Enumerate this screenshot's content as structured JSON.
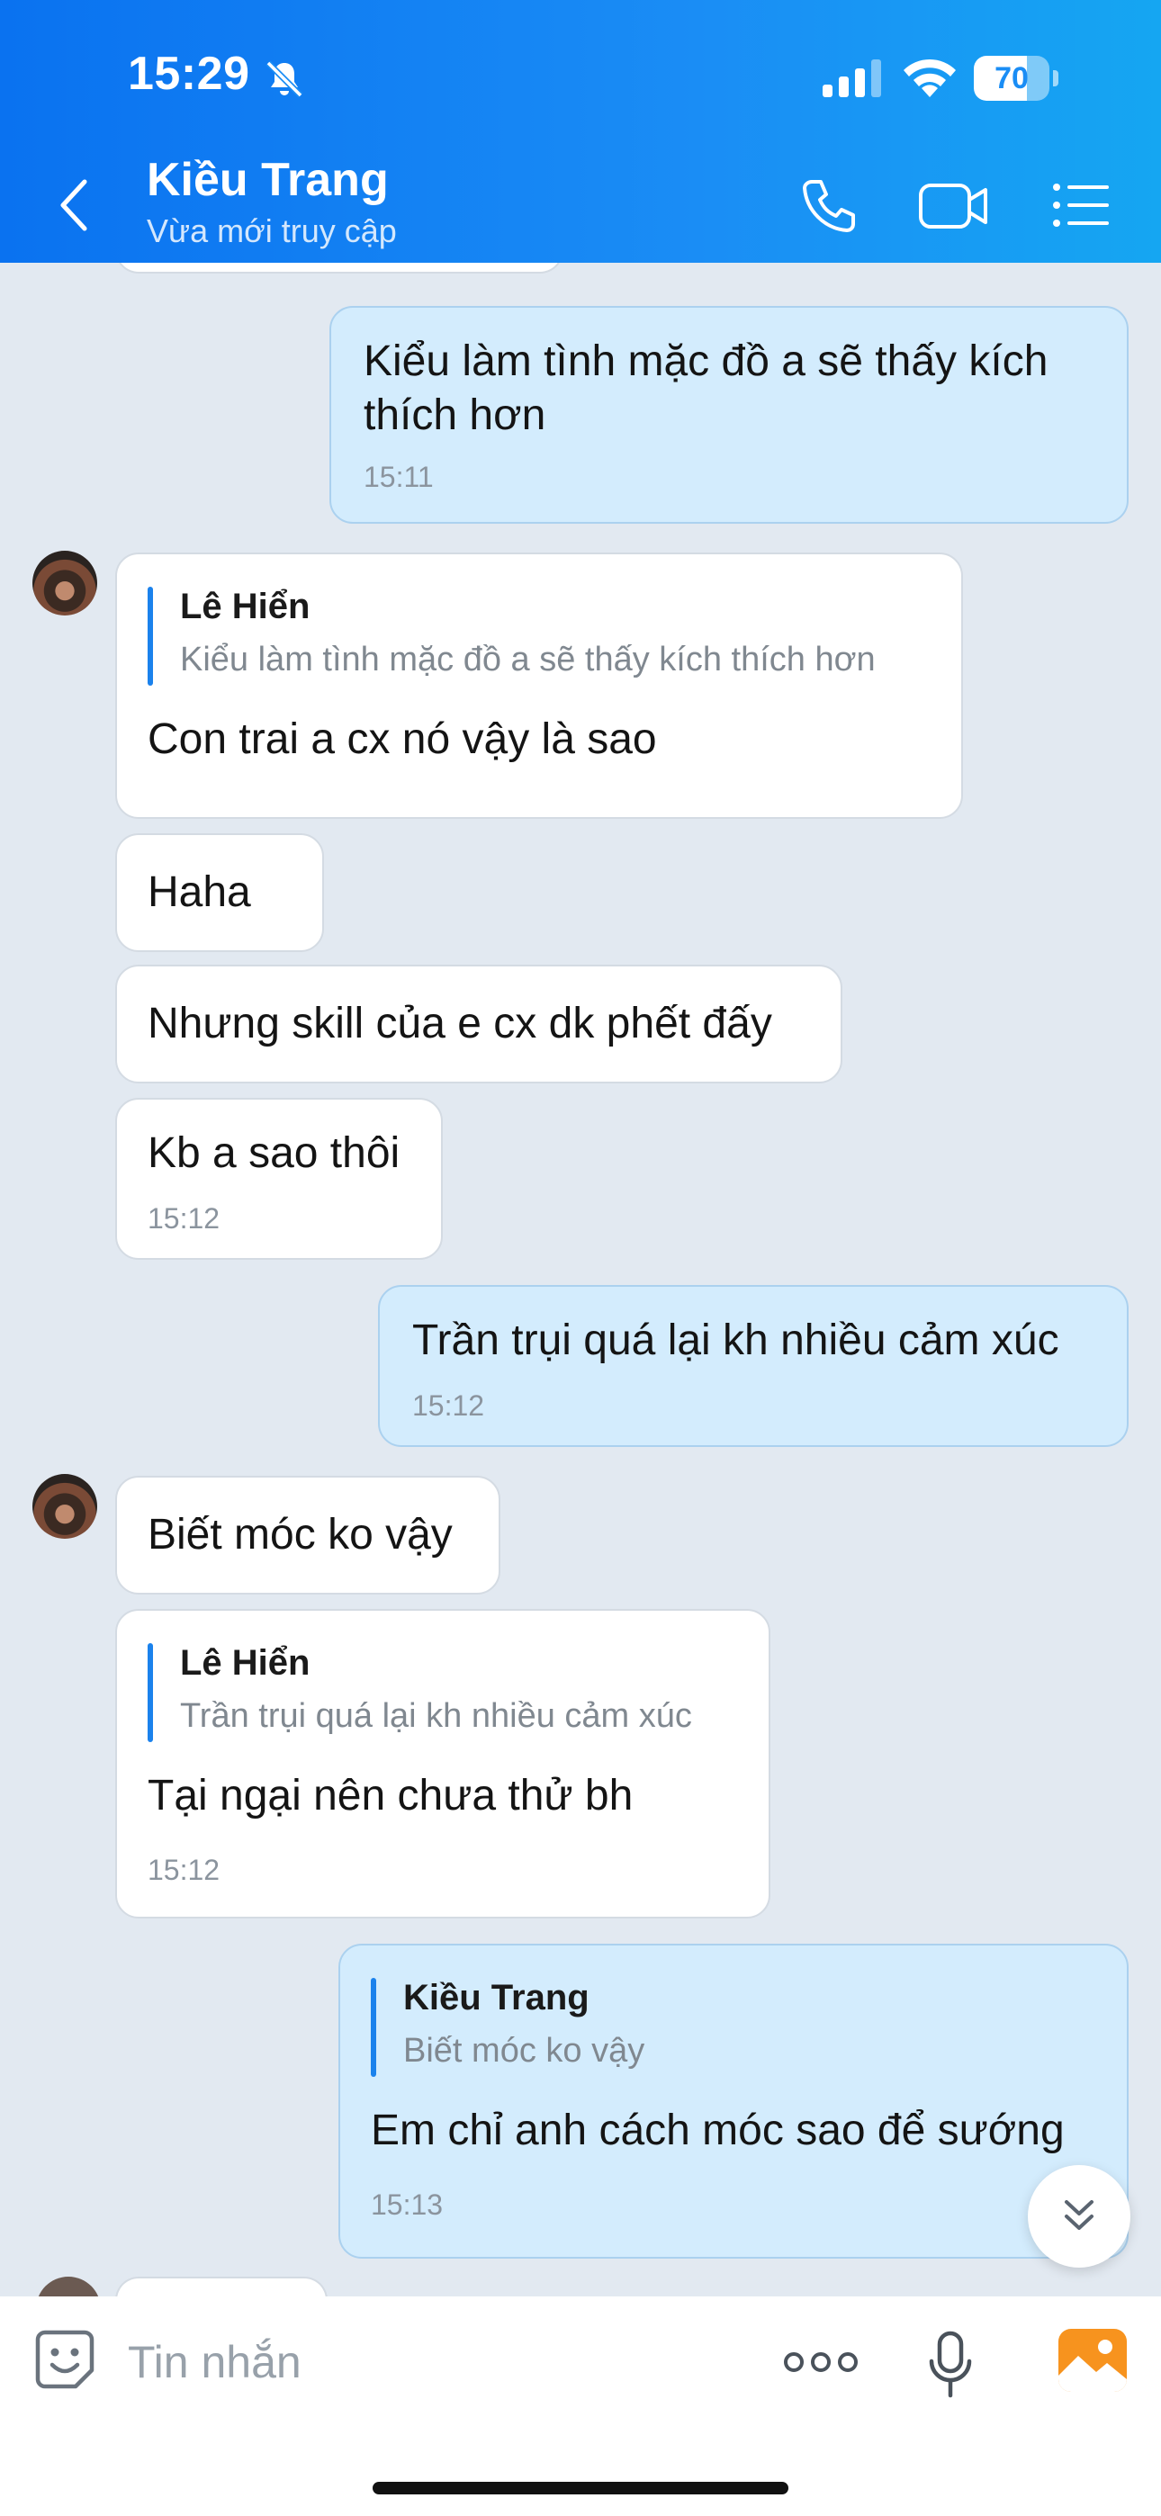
{
  "status_bar": {
    "time": "15:29",
    "battery": "70",
    "battery_level": 0.7
  },
  "header": {
    "contact_name": "Kiều Trang",
    "contact_status": "Vừa mới truy cập"
  },
  "messages": [
    {
      "id": 1,
      "direction": "out",
      "text_lines": [
        "Kiểu làm tình mặc đồ a sẽ thấy kích",
        "thích hơn"
      ],
      "time": "15:11"
    },
    {
      "id": 2,
      "direction": "in",
      "quote_author": "Lê Hiển",
      "quote_text": "Kiểu làm tình mặc đồ a sẽ thấy kích thích hơn",
      "text": "Con trai a cx nó vậy là sao"
    },
    {
      "id": 3,
      "direction": "in",
      "text": "Haha"
    },
    {
      "id": 4,
      "direction": "in",
      "text": "Nhưng skill của e cx dk phết đấy"
    },
    {
      "id": 5,
      "direction": "in",
      "text": "Kb a sao thôi",
      "time": "15:12"
    },
    {
      "id": 6,
      "direction": "out",
      "text": "Trần trụi quá lại kh nhiều cảm xúc",
      "time": "15:12"
    },
    {
      "id": 7,
      "direction": "in",
      "text": "Biết móc ko vậy"
    },
    {
      "id": 8,
      "direction": "in",
      "quote_author": "Lê Hiển",
      "quote_text": "Trần trụi quá lại kh nhiều cảm xúc",
      "text": "Tại ngại nên chưa thử bh",
      "time": "15:12"
    },
    {
      "id": 9,
      "direction": "out",
      "quote_author": "Kiều Trang",
      "quote_text": "Biết móc ko vậy",
      "text": "Em chỉ anh cách móc sao để sướng",
      "time": "15:13"
    }
  ],
  "input": {
    "placeholder": "Tin nhắn"
  },
  "colors": {
    "header_start": "#0a72f0",
    "header_end": "#15a6f2",
    "outgoing_bubble": "#d3ecfd",
    "incoming_bubble": "#ffffff",
    "quote_bar": "#1b82ec",
    "chat_background": "#e2e9f1"
  }
}
